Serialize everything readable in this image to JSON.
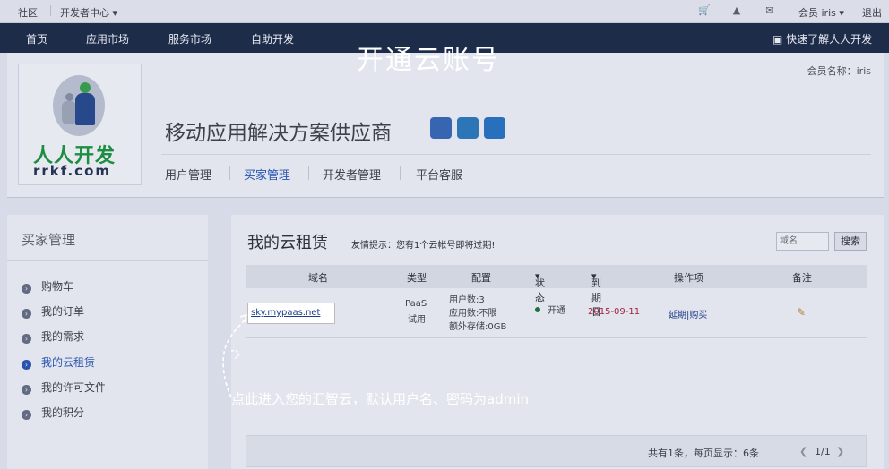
{
  "topbar": {
    "community": "社区",
    "dev_center": "开发者中心",
    "member": "会员 iris",
    "logout": "退出"
  },
  "nav": {
    "items": [
      "首页",
      "应用市场",
      "服务市场",
      "自助开发"
    ],
    "quick": "快速了解人人开发"
  },
  "overlay_title": "开通云账号",
  "header": {
    "member_name": "会员名称：iris",
    "logo_cn": "人人开发",
    "logo_en": "rrkf.com",
    "title": "移动应用解决方案供应商",
    "tabs": [
      "用户管理",
      "买家管理",
      "开发者管理",
      "平台客服"
    ]
  },
  "sidebar": {
    "title": "买家管理",
    "items": [
      "购物车",
      "我的订单",
      "我的需求",
      "我的云租赁",
      "我的许可文件",
      "我的积分"
    ],
    "active_index": 3
  },
  "main": {
    "title": "我的云租赁",
    "tip": "友情提示：您有1个云帐号即将过期!",
    "search_placeholder": "域名",
    "search_button": "搜索",
    "columns": [
      "域名",
      "类型",
      "配置",
      "状态",
      "到期日",
      "操作项",
      "备注"
    ],
    "row": {
      "domain": "sky.mypaas.net",
      "type_line1": "PaaS",
      "type_line2": "试用",
      "config": [
        "用户数:3",
        "应用数:不限",
        "额外存储:0GB"
      ],
      "status": "开通",
      "expiry": "2015-09-11",
      "action": "延期|购买"
    },
    "footer": {
      "summary": "共有1条，每页显示：6条",
      "page": "1/1"
    }
  },
  "hint": "点此进入您的汇智云，默认用户名、密码为admin",
  "colors": {
    "nav_bg": "#1f2d45",
    "status_green": "#1f7a3a",
    "expiry_red": "#b0223a",
    "link_blue": "#1d3f8a"
  }
}
